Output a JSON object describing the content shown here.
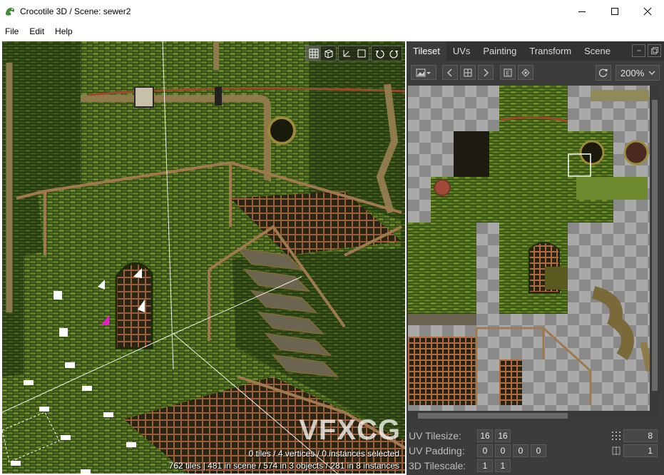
{
  "window": {
    "title": "Crocotile 3D / Scene: sewer2",
    "app_icon": "crocodile-app-icon",
    "controls": [
      "minimize-icon",
      "maximize-icon",
      "close-icon"
    ]
  },
  "menu": {
    "items": [
      "File",
      "Edit",
      "Help"
    ]
  },
  "viewport": {
    "toolbar_icons": [
      "tile-grid-icon",
      "cube-icon",
      "move-gizmo-icon",
      "square-select-icon",
      "undo-icon",
      "redo-icon"
    ],
    "status_line1": "0 tiles / 4 vertices / 0 instances selected",
    "status_line2": "762 tiles | 481 in scene / 574 in 3 objects / 281 in 8 instances",
    "watermark": "VFXCG",
    "colors": {
      "brick_green": "#4d6a1f",
      "dark_green": "#223612",
      "rust": "#7a4a2a",
      "highlight_vertex": "#e020c0"
    }
  },
  "panel": {
    "tabs": [
      "Tileset",
      "UVs",
      "Painting",
      "Transform",
      "Scene"
    ],
    "active_tab": "Tileset",
    "toolbar_icons": [
      "image-icon",
      "prev-icon",
      "grid-select-icon",
      "next-icon",
      "edit-e-icon",
      "layers-diamond-icon"
    ],
    "zoom": "200%",
    "refresh_icon": "refresh-icon"
  },
  "properties": {
    "uv_tilesize_label": "UV Tilesize:",
    "uv_tilesize": [
      "16",
      "16"
    ],
    "uv_padding_label": "UV Padding:",
    "uv_padding": [
      "0",
      "0",
      "0",
      "0"
    ],
    "tilescale_label": "3D Tilescale:",
    "tilescale": [
      "1",
      "1"
    ],
    "grid_value": "8",
    "flip_value": "1"
  }
}
